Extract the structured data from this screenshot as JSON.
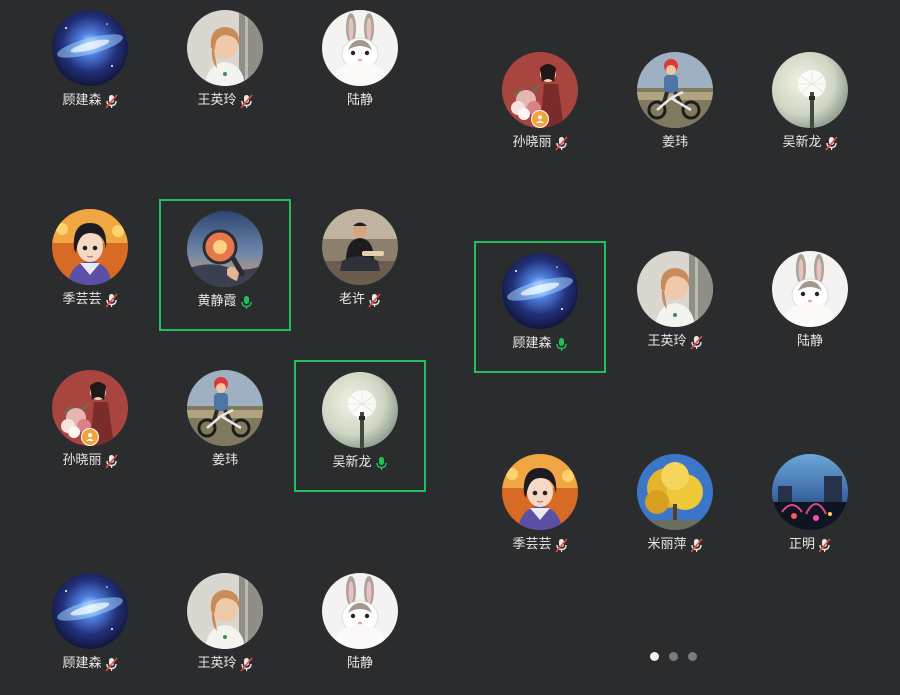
{
  "left_grid": {
    "members": [
      {
        "name": "顾建森",
        "avatar": "galaxy",
        "mic": "muted",
        "speaking": false,
        "host": false
      },
      {
        "name": "王英玲",
        "avatar": "woman-portrait",
        "mic": "muted",
        "speaking": false,
        "host": false
      },
      {
        "name": "陆静",
        "avatar": "rabbit",
        "mic": "none",
        "speaking": false,
        "host": false
      },
      {
        "name": "季芸芸",
        "avatar": "cartoon-girl",
        "mic": "muted",
        "speaking": false,
        "host": false
      },
      {
        "name": "黄静霞",
        "avatar": "magnifier-sunset",
        "mic": "active",
        "speaking": true,
        "host": false
      },
      {
        "name": "老许",
        "avatar": "man-crouching",
        "mic": "muted",
        "speaking": false,
        "host": false
      },
      {
        "name": "孙晓丽",
        "avatar": "woman-flowers",
        "mic": "muted",
        "speaking": false,
        "host": true
      },
      {
        "name": "姜玮",
        "avatar": "child-bike",
        "mic": "none",
        "speaking": false,
        "host": false
      },
      {
        "name": "吴新龙",
        "avatar": "dandelion",
        "mic": "active",
        "speaking": true,
        "host": false
      },
      {
        "name": "顾建森",
        "avatar": "galaxy",
        "mic": "muted",
        "speaking": false,
        "host": false
      },
      {
        "name": "王英玲",
        "avatar": "woman-portrait",
        "mic": "muted",
        "speaking": false,
        "host": false
      },
      {
        "name": "陆静",
        "avatar": "rabbit",
        "mic": "none",
        "speaking": false,
        "host": false
      }
    ]
  },
  "right_grid": {
    "members": [
      {
        "name": "孙晓丽",
        "avatar": "woman-flowers",
        "mic": "muted",
        "speaking": false,
        "host": true
      },
      {
        "name": "姜玮",
        "avatar": "child-bike",
        "mic": "none",
        "speaking": false,
        "host": false
      },
      {
        "name": "吴新龙",
        "avatar": "dandelion",
        "mic": "muted",
        "speaking": false,
        "host": false
      },
      {
        "name": "顾建森",
        "avatar": "galaxy",
        "mic": "active",
        "speaking": true,
        "host": false
      },
      {
        "name": "王英玲",
        "avatar": "woman-portrait",
        "mic": "muted",
        "speaking": false,
        "host": false
      },
      {
        "name": "陆静",
        "avatar": "rabbit",
        "mic": "none",
        "speaking": false,
        "host": false
      },
      {
        "name": "季芸芸",
        "avatar": "cartoon-girl",
        "mic": "muted",
        "speaking": false,
        "host": false
      },
      {
        "name": "米丽萍",
        "avatar": "ginkgo-tree",
        "mic": "muted",
        "speaking": false,
        "host": false
      },
      {
        "name": "正明",
        "avatar": "night-fountain",
        "mic": "muted",
        "speaking": false,
        "host": false
      }
    ]
  },
  "pagination": {
    "pages": 3,
    "current": 1
  },
  "colors": {
    "background": "#2b2c2e",
    "speaking_border": "#20c05c",
    "mic_active": "#20c05c",
    "mic_muted": "#e8e8e8",
    "muted_slash": "#e6463c",
    "host_badge": "#f2a33a"
  }
}
